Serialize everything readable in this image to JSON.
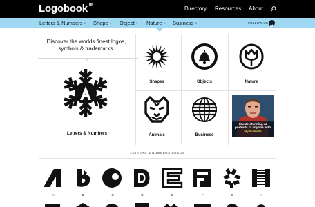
{
  "brand": {
    "name": "Logobook",
    "mark": "TM"
  },
  "top_nav": [
    {
      "label": "Directory"
    },
    {
      "label": "Resources"
    },
    {
      "label": "About"
    }
  ],
  "categories": [
    {
      "label": "Letters & Numbers"
    },
    {
      "label": "Shape"
    },
    {
      "label": "Object"
    },
    {
      "label": "Nature"
    },
    {
      "label": "Business"
    }
  ],
  "follow_label": "FOLLOW US",
  "hero": {
    "tagline": "Discover the worlds finest logos, symbols & trademarks.",
    "feature_label": "Letters & Numbers"
  },
  "tiles": [
    {
      "label": "Shapes",
      "icon": "sunburst-icon"
    },
    {
      "label": "Objects",
      "icon": "bell-icon"
    },
    {
      "label": "Nature",
      "icon": "tulip-icon"
    },
    {
      "label": "Animals",
      "icon": "tiger-icon"
    },
    {
      "label": "Business",
      "icon": "globe-icon"
    }
  ],
  "promo": {
    "text_before": "Create stunning AI portraits of anyone with ",
    "highlight": "MyPortraits"
  },
  "section": {
    "title": "LETTERS & NUMBERS LOGOS"
  },
  "letters": [
    "A",
    "B",
    "C",
    "D",
    "E",
    "F",
    "G",
    "H"
  ],
  "colors": {
    "topbar": "#000000",
    "catbar": "#9fd8f2",
    "accent_yellow": "#f2d04a"
  }
}
